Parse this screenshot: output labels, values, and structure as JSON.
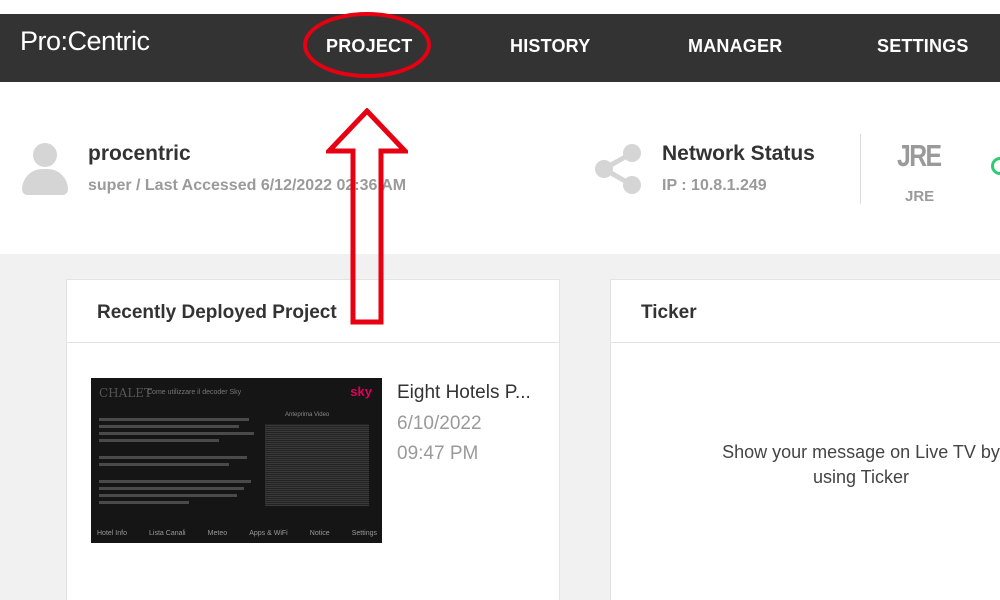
{
  "navbar": {
    "logo": "Pro:Centric",
    "items": [
      {
        "label": "PROJECT"
      },
      {
        "label": "HISTORY"
      },
      {
        "label": "MANAGER"
      },
      {
        "label": "SETTINGS"
      }
    ]
  },
  "user": {
    "name": "procentric",
    "subtitle": "super / Last Accessed 6/12/2022 02:36 AM"
  },
  "network": {
    "title": "Network Status",
    "ip": "IP : 10.8.1.249"
  },
  "jre": {
    "icon_text": "JRE",
    "label": "JRE"
  },
  "recent_project": {
    "card_title": "Recently Deployed Project",
    "name": "Eight Hotels P...",
    "date": "6/10/2022",
    "time": "09:47 PM",
    "thumbnail": {
      "brand": "sky",
      "title": "Come utilizzare il decoder Sky",
      "video_label": "Anteprima Video",
      "menu": [
        "Hotel Info",
        "Lista Canali",
        "Meteo",
        "Apps & WiFi",
        "Notice",
        "Settings"
      ]
    }
  },
  "ticker": {
    "card_title": "Ticker",
    "message": "Show your message on Live TV by using Ticker"
  },
  "annotations": {
    "highlight_color": "#e60012"
  },
  "colors": {
    "navbar_bg": "#333333",
    "content_bg": "#f1f1f1",
    "status_green": "#2ecc71"
  }
}
